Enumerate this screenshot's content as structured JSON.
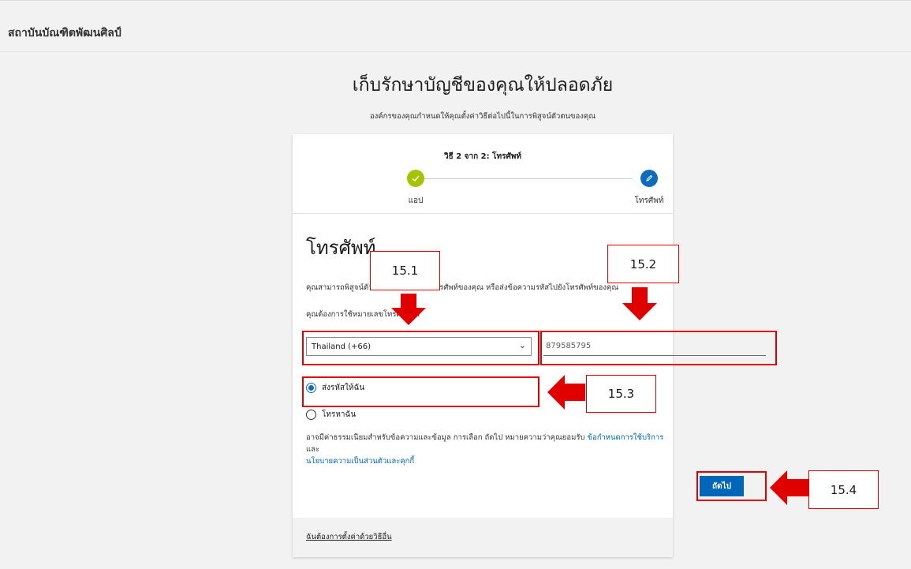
{
  "org": {
    "name": "สถาบันบัณฑิตพัฒนศิลป์"
  },
  "page": {
    "headline": "เก็บรักษาบัญชีของคุณให้ปลอดภัย",
    "subheadline": "องค์กรของคุณกำหนดให้คุณตั้งค่าวิธีต่อไปนี้ในการพิสูจน์ตัวตนของคุณ"
  },
  "steps": {
    "title": "วิธี 2 จาก 2: โทรศัพท์",
    "items": [
      {
        "label": "แอป",
        "state": "done"
      },
      {
        "label": "โทรศัพท์",
        "state": "current"
      }
    ]
  },
  "phone": {
    "section_title": "โทรศัพท์",
    "description": "คุณสามารถพิสูจน์ตัวตนโดยการรับสายโทรศัพท์ของคุณ หรือส่งข้อความรหัสไปยังโทรศัพท์ของคุณ",
    "question": "คุณต้องการใช้หมายเลขโทรศัพท์ใด",
    "country_value": "Thailand (+66)",
    "number_value": "879585795",
    "options": [
      {
        "label": "ส่งรหัสให้ฉัน",
        "selected": true
      },
      {
        "label": "โทรหาฉัน",
        "selected": false
      }
    ],
    "legal_text": "อาจมีค่าธรรมเนียมสำหรับข้อความและข้อมูล การเลือก ถัดไป หมายความว่าคุณยอมรับ",
    "terms_link": "ข้อกำหนดการใช้บริการ",
    "and_text": "และ",
    "privacy_link": "นโยบายความเป็นส่วนตัวและคุกกี้",
    "next_label": "ถัดไป",
    "alt_method_link": "ฉันต้องการตั้งค่าด้วยวิธีอื่น"
  },
  "annotations": {
    "accent_color": "#e00000",
    "labels": [
      "15.1",
      "15.2",
      "15.3",
      "15.4"
    ]
  }
}
